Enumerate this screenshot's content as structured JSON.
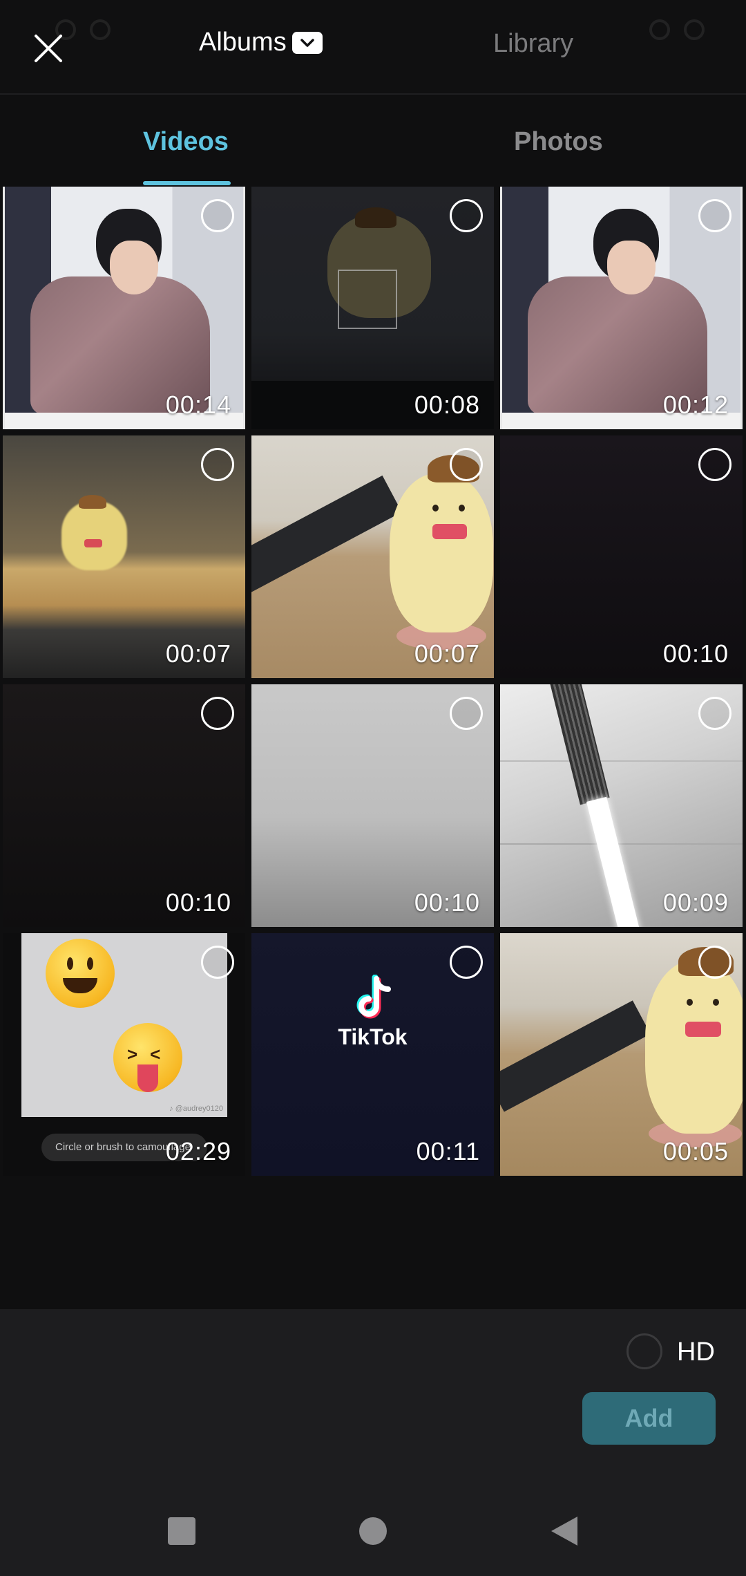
{
  "header": {
    "albums_label": "Albums",
    "library_label": "Library"
  },
  "tabs": [
    {
      "label": "Videos",
      "active": true
    },
    {
      "label": "Photos",
      "active": false
    }
  ],
  "media": [
    {
      "duration": "00:14",
      "thumb": "person"
    },
    {
      "duration": "00:08",
      "thumb": "dark-desk-toy"
    },
    {
      "duration": "00:12",
      "thumb": "person"
    },
    {
      "duration": "00:07",
      "thumb": "blurred-toy"
    },
    {
      "duration": "00:07",
      "thumb": "toy-closeup"
    },
    {
      "duration": "00:10",
      "thumb": "black"
    },
    {
      "duration": "00:10",
      "thumb": "black"
    },
    {
      "duration": "00:10",
      "thumb": "gray"
    },
    {
      "duration": "00:09",
      "thumb": "ceiling-light"
    },
    {
      "duration": "02:29",
      "thumb": "emoji",
      "caption": "Circle or brush to camouflage",
      "handle": "♪ @audrey0120"
    },
    {
      "duration": "00:11",
      "thumb": "tiktok",
      "logo_text": "TikTok"
    },
    {
      "duration": "00:05",
      "thumb": "toy-closeup"
    }
  ],
  "footer": {
    "hd_label": "HD",
    "add_label": "Add"
  },
  "colors": {
    "accent": "#5ec3df",
    "add_button_bg": "#2e6b78",
    "add_button_text": "#6fa9b6",
    "background": "#0f0f10",
    "panel": "#1d1d1f"
  },
  "icons": {
    "close": "close-icon",
    "albums_dropdown": "chevron-down-icon",
    "select": "selection-circle-icon",
    "nav_recents": "square-icon",
    "nav_home": "circle-icon",
    "nav_back": "triangle-back-icon"
  }
}
